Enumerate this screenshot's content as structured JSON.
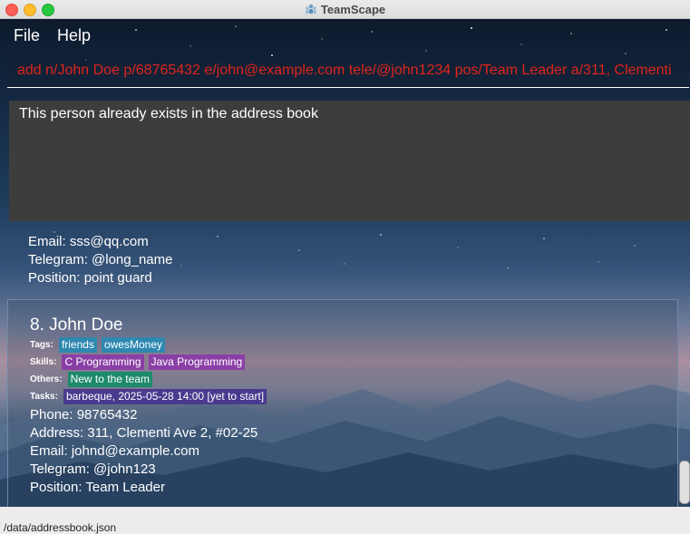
{
  "window": {
    "title": "TeamScape"
  },
  "menu": {
    "file": "File",
    "help": "Help"
  },
  "command_box": {
    "value": "add n/John Doe p/68765432 e/john@example.com tele/@john1234 pos/Team Leader a/311, Clementi"
  },
  "result": {
    "message": "This person already exists in the address book"
  },
  "previous_person": {
    "email": "Email: sss@qq.com",
    "telegram": "Telegram: @long_name",
    "position": "Position: point guard"
  },
  "person": {
    "name": "8.  John Doe",
    "tags_label": "Tags:",
    "tags": [
      "friends",
      "owesMoney"
    ],
    "skills_label": "Skills:",
    "skills": [
      "C Programming",
      "Java Programming"
    ],
    "others_label": "Others:",
    "others": [
      "New to the team"
    ],
    "tasks_label": "Tasks:",
    "tasks": [
      "barbeque, 2025-05-28 14:00 [yet to start]"
    ],
    "phone": "Phone: 98765432",
    "address": "Address: 311, Clementi Ave 2, #02-25",
    "email": "Email: johnd@example.com",
    "telegram": "Telegram: @john123",
    "position": "Position: Team Leader"
  },
  "status_bar": {
    "path": "/data/addressbook.json"
  },
  "colors": {
    "command_text": "#e0241c",
    "result_bg": "#3d3d3d",
    "tag": "#2e88b0",
    "skill": "#8a3fa6",
    "other": "#1e8a6c",
    "task": "#4a3a8e"
  }
}
